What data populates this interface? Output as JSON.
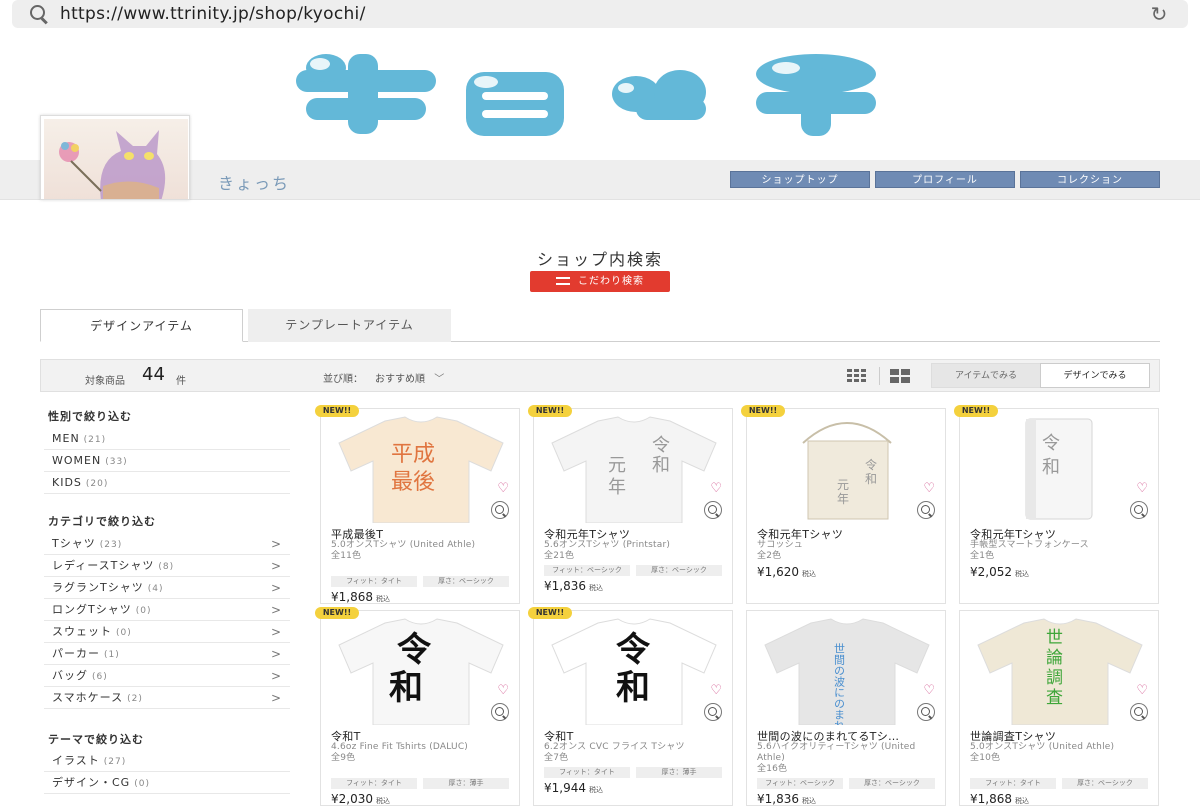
{
  "browser": {
    "url": "https://www.ttrinity.jp/shop/kyochi/"
  },
  "shop": {
    "name": "きょっち",
    "nav": [
      "ショップトップ",
      "プロフィール",
      "コレクション"
    ]
  },
  "search": {
    "title": "ショップ内検索",
    "button": "こだわり検索"
  },
  "tabs": [
    "デザインアイテム",
    "テンプレートアイテム"
  ],
  "sortbar": {
    "count_label": "対象商品",
    "count": "44",
    "count_unit": "件",
    "sort_label": "並び順：",
    "sort_value": "おすすめ順",
    "view_items": "アイテムでみる",
    "view_designs": "デザインでみる"
  },
  "sidebar": {
    "gender_title": "性別で絞り込む",
    "gender": [
      {
        "label": "MEN",
        "count": "(21)"
      },
      {
        "label": "WOMEN",
        "count": "(33)"
      },
      {
        "label": "KIDS",
        "count": "(20)"
      }
    ],
    "category_title": "カテゴリで絞り込む",
    "categories": [
      {
        "label": "Tシャツ",
        "count": "(23)"
      },
      {
        "label": "レディースTシャツ",
        "count": "(8)"
      },
      {
        "label": "ラグランTシャツ",
        "count": "(4)"
      },
      {
        "label": "ロングTシャツ",
        "count": "(0)"
      },
      {
        "label": "スウェット",
        "count": "(0)"
      },
      {
        "label": "パーカー",
        "count": "(1)"
      },
      {
        "label": "バッグ",
        "count": "(6)"
      },
      {
        "label": "スマホケース",
        "count": "(2)"
      }
    ],
    "theme_title": "テーマで絞り込む",
    "themes": [
      {
        "label": "イラスト",
        "count": "(27)"
      },
      {
        "label": "デザイン・CG",
        "count": "(0)"
      }
    ]
  },
  "products": [
    {
      "badge": "NEW!!",
      "title": "平成最後T",
      "sub": "5.0オンスTシャツ (United Athle)",
      "colors": "全11色",
      "tags": [
        "フィット：タイト",
        "厚さ：ベーシック"
      ],
      "price": "¥1,868",
      "tax": "税込",
      "print": "平成最後"
    },
    {
      "badge": "NEW!!",
      "title": "令和元年Tシャツ",
      "sub": "5.6オンスTシャツ (Printstar)",
      "colors": "全21色",
      "tags": [
        "フィット：ベーシック",
        "厚さ：ベーシック"
      ],
      "price": "¥1,836",
      "tax": "税込",
      "print": "令和元年"
    },
    {
      "badge": "NEW!!",
      "title": "令和元年Tシャツ",
      "sub": "サコッシュ",
      "colors": "全2色",
      "tags": [],
      "price": "¥1,620",
      "tax": "税込",
      "print": "令和元年"
    },
    {
      "badge": "NEW!!",
      "title": "令和元年Tシャツ",
      "sub": "手帳型スマートフォンケース",
      "colors": "全1色",
      "tags": [],
      "price": "¥2,052",
      "tax": "税込",
      "print": "令和"
    },
    {
      "badge": "NEW!!",
      "title": "令和T",
      "sub": "4.6oz Fine Fit Tshirts (DALUC)",
      "colors": "全9色",
      "tags": [
        "フィット：タイト",
        "厚さ：薄手"
      ],
      "price": "¥2,030",
      "tax": "税込",
      "print": "令和"
    },
    {
      "badge": "NEW!!",
      "title": "令和T",
      "sub": "6.2オンス CVC フライス Tシャツ",
      "colors": "全7色",
      "tags": [
        "フィット：タイト",
        "厚さ：薄手"
      ],
      "price": "¥1,944",
      "tax": "税込",
      "print": "令和"
    },
    {
      "badge": "",
      "title": "世間の波にのまれてるTシ…",
      "sub": "5.6ハイクオリティーTシャツ (United Athle)",
      "colors": "全16色",
      "tags": [
        "フィット：ベーシック",
        "厚さ：ベーシック"
      ],
      "price": "¥1,836",
      "tax": "税込",
      "print": "世間の波にのまれ隊"
    },
    {
      "badge": "",
      "title": "世論調査Tシャツ",
      "sub": "5.0オンスTシャツ (United Athle)",
      "colors": "全10色",
      "tags": [
        "フィット：タイト",
        "厚さ：ベーシック"
      ],
      "price": "¥1,868",
      "tax": "税込",
      "print": "世論調査"
    }
  ],
  "colors": {
    "logo": "#63b8d8",
    "nav_button": "#6f8bb4",
    "search_button": "#e23b2f",
    "badge": "#f4d13d",
    "heart": "#d04f8a"
  }
}
